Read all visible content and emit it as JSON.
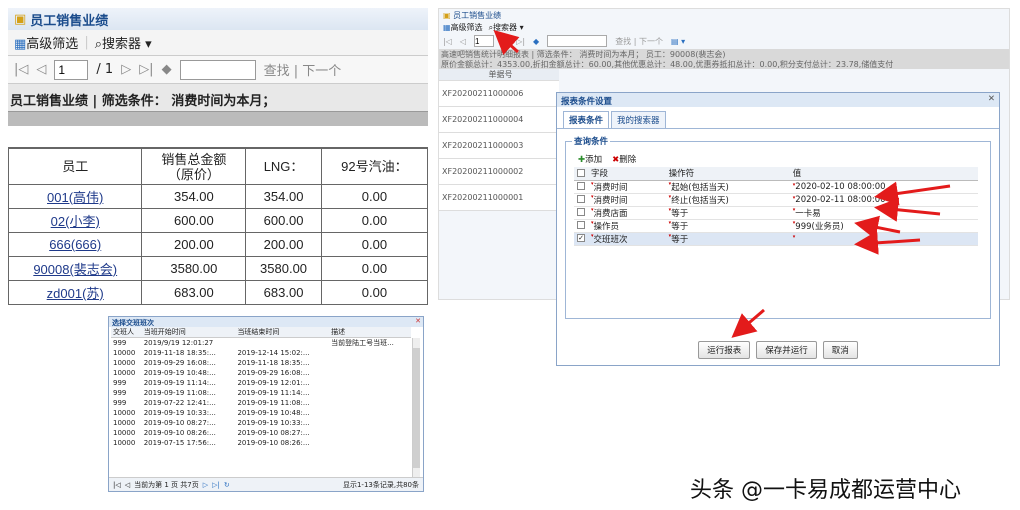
{
  "left_panel": {
    "title": "员工销售业绩",
    "toolbar": {
      "advanced_filter": "高级筛选",
      "search_engine": "搜索器"
    },
    "pager": {
      "page": "1",
      "total": "/ 1",
      "search_link": "查找 | 下一个"
    },
    "report_header": "员工销售业绩 | 筛选条件： 消费时间为本月；",
    "columns": [
      "员工",
      "销售总金额\n（原价）",
      "LNG：",
      "92号汽油："
    ],
    "rows": [
      [
        "001(高伟)",
        "354.00",
        "354.00",
        "0.00"
      ],
      [
        "02(小李)",
        "600.00",
        "600.00",
        "0.00"
      ],
      [
        "666(666)",
        "200.00",
        "200.00",
        "0.00"
      ],
      [
        "90008(裴志会)",
        "3580.00",
        "3580.00",
        "0.00"
      ],
      [
        "zd001(苏)",
        "683.00",
        "683.00",
        "0.00"
      ]
    ]
  },
  "shift_dialog": {
    "title": "选择交班班次",
    "columns": [
      "交班人",
      "当班开始时间",
      "当班结束时间",
      "描述"
    ],
    "rows": [
      [
        "999",
        "2019/9/19 12:01:27",
        "",
        "当前登陆工号当班..."
      ],
      [
        "10000",
        "2019-11-18 18:35:...",
        "2019-12-14 15:02:...",
        ""
      ],
      [
        "10000",
        "2019-09-29 16:08:...",
        "2019-11-18 18:35:...",
        ""
      ],
      [
        "10000",
        "2019-09-19 10:48:...",
        "2019-09-29 16:08:...",
        ""
      ],
      [
        "999",
        "2019-09-19 11:14:...",
        "2019-09-19 12:01:...",
        ""
      ],
      [
        "999",
        "2019-09-19 11:08:...",
        "2019-09-19 11:14:...",
        ""
      ],
      [
        "999",
        "2019-07-22 12:41:...",
        "2019-09-19 11:08:...",
        ""
      ],
      [
        "10000",
        "2019-09-19 10:33:...",
        "2019-09-19 10:48:...",
        ""
      ],
      [
        "10000",
        "2019-09-10 08:27:...",
        "2019-09-19 10:33:...",
        ""
      ],
      [
        "10000",
        "2019-09-10 08:26:...",
        "2019-09-10 08:27:...",
        ""
      ],
      [
        "10000",
        "2019-07-15 17:56:...",
        "2019-09-10 08:26:...",
        ""
      ]
    ],
    "footer_page": "当前为第  1  页 共7页",
    "footer_count": "显示1-13条记录,共80条"
  },
  "right_panel": {
    "title": "员工销售业绩",
    "advanced_filter": "高级筛选",
    "search_engine": "搜索器",
    "page": "1",
    "search_link": "查找 | 下一个",
    "info1": "高速吧销售统计明细报表 | 筛选条件： 消费时间为本月； 员工：90008(裴志会)",
    "info2": "原价金额总计：4353.00,折扣金额总计：60.00,其他优惠总计：48.00,优惠券抵扣总计：0.00,积分支付总计：23.78,储值支付",
    "col_header": "单据号",
    "order_ids": [
      "XF20200211000006",
      "XF20200211000004",
      "XF20200211000003",
      "XF20200211000002",
      "XF20200211000001"
    ]
  },
  "criteria_dialog": {
    "title": "报表条件设置",
    "tabs": [
      "报表条件",
      "我的搜索器"
    ],
    "group": "查询条件",
    "add": "添加",
    "delete": "删除",
    "columns": [
      "字段",
      "操作符",
      "值"
    ],
    "rows": [
      {
        "field": "消费时间",
        "op": "起始(包括当天)",
        "value": "2020-02-10 08:00:00",
        "checked": false
      },
      {
        "field": "消费时间",
        "op": "终止(包括当天)",
        "value": "2020-02-11 08:00:00",
        "checked": false
      },
      {
        "field": "消费店面",
        "op": "等于",
        "value": "一卡易",
        "checked": false
      },
      {
        "field": "操作员",
        "op": "等于",
        "value": "999(业务员)",
        "checked": false
      },
      {
        "field": "交班班次",
        "op": "等于",
        "value": "",
        "checked": true
      }
    ],
    "buttons": [
      "运行报表",
      "保存并运行",
      "取消"
    ]
  },
  "watermark": "头条 @一卡易成都运营中心",
  "colors": {
    "arrow": "#e31b1b",
    "link": "#1f3a8a",
    "title": "#1b4c8c"
  }
}
